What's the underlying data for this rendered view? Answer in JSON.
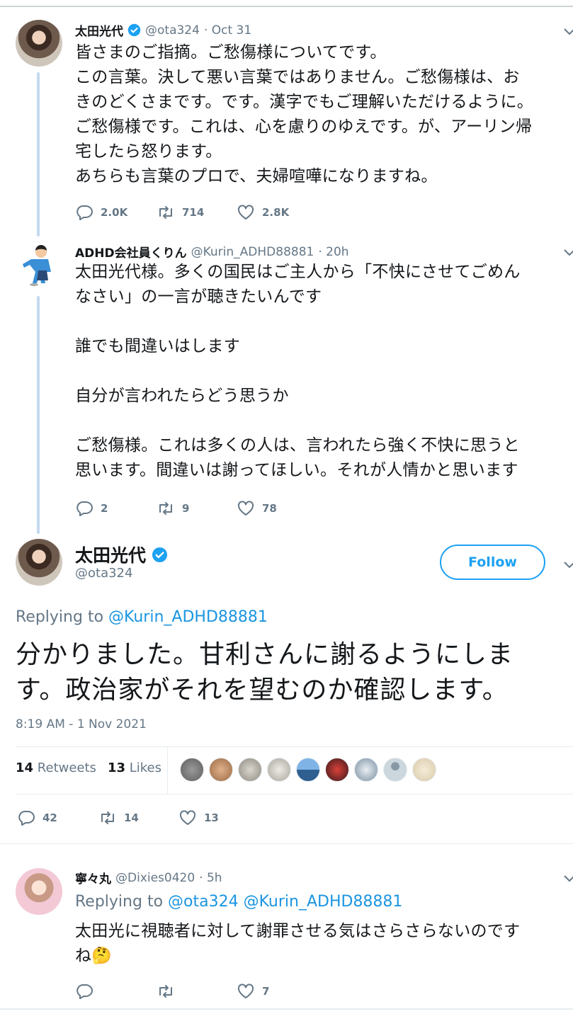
{
  "tweet1": {
    "name": "太田光代",
    "handle": "@ota324",
    "time": "· Oct 31",
    "lines": [
      "皆さまのご指摘。ご愁傷様についてです。",
      "この言葉。決して悪い言葉ではありません。ご愁傷様は、お",
      "きのどくさまです。です。漢字でもご理解いただけるように。",
      "ご愁傷様です。これは、心を慮りのゆえです。が、アーリン帰",
      "宅したら怒ります。",
      "あちらも言葉のプロで、夫婦喧嘩になりますね。"
    ],
    "replies": "2.0K",
    "retweets": "714",
    "likes": "2.8K"
  },
  "tweet2": {
    "name": "ADHD会社員くりん",
    "handle": "@Kurin_ADHD88881",
    "time": "· 20h",
    "lines": [
      "太田光代様。多くの国民はご主人から「不快にさせてごめん",
      "なさい」の一言が聴きたいんです",
      "",
      "誰でも間違いはします",
      "",
      "自分が言われたらどう思うか",
      "",
      "ご愁傷様。これは多くの人は、言われたら強く不快に思うと",
      "思います。間違いは謝ってほしい。それが人情かと思います"
    ],
    "replies": "2",
    "retweets": "9",
    "likes": "78"
  },
  "main": {
    "name": "太田光代",
    "handle": "@ota324",
    "follow_label": "Follow",
    "replying_prefix": "Replying to",
    "replying_to": "@Kurin_ADHD88881",
    "lines": [
      "分かりました。甘利さんに謝るようにしま",
      "す。政治家がそれを望むのか確認します。"
    ],
    "timestamp": "8:19 AM - 1 Nov 2021",
    "retweet_count": "14",
    "retweet_label": "Retweets",
    "like_count": "13",
    "like_label": "Likes",
    "replies": "42",
    "retweets": "14",
    "likes": "13"
  },
  "tweet3": {
    "name": "寧々丸",
    "handle": "@Dixies0420",
    "time": "· 5h",
    "replying_prefix": "Replying to",
    "replying_to": "@ota324 @Kurin_ADHD88881",
    "lines": [
      "太田光に視聴者に対して謝罪させる気はさらさらないのです",
      "ね🤔"
    ],
    "replies": "",
    "retweets": "",
    "likes": "7"
  },
  "colors": {
    "accent": "#1da1f2",
    "mention": "#1b95e0",
    "muted": "#657786",
    "thread_line": "#c4d9ef"
  }
}
